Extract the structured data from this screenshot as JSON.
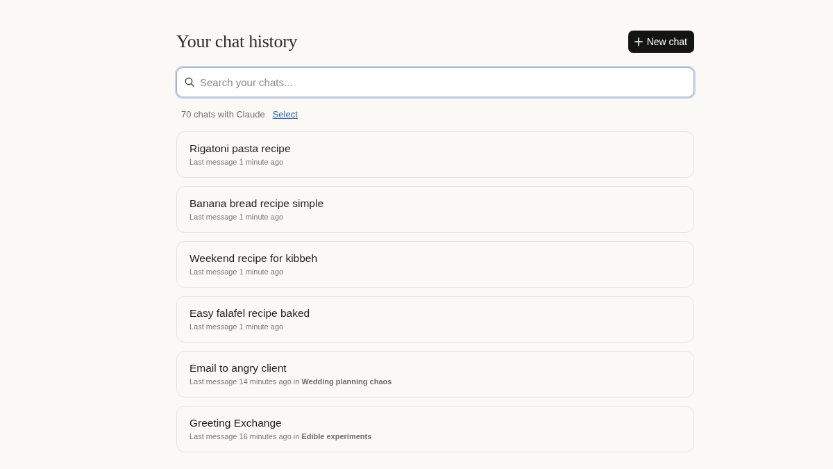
{
  "header": {
    "title": "Your chat history",
    "new_chat_button": "New chat"
  },
  "search": {
    "placeholder": "Search your chats...",
    "focused": true
  },
  "summary": {
    "count": "70 chats with Claude",
    "select_link": "Select"
  },
  "chats": [
    {
      "title": "Rigatoni pasta recipe",
      "meta": "Last message 1 minute ago"
    },
    {
      "title": "Banana bread recipe simple",
      "meta": "Last message 1 minute ago"
    },
    {
      "title": "Weekend recipe for kibbeh",
      "meta": "Last message 1 minute ago"
    },
    {
      "title": "Easy falafel recipe baked",
      "meta": "Last message 1 minute ago"
    },
    {
      "title": "Email to angry client",
      "meta": "Last message 14 minutes ago in **Wedding planning chaos**"
    },
    {
      "title": "Greeting Exchange",
      "meta": "Last message 16 minutes ago in **Edible experiments**"
    }
  ]
}
